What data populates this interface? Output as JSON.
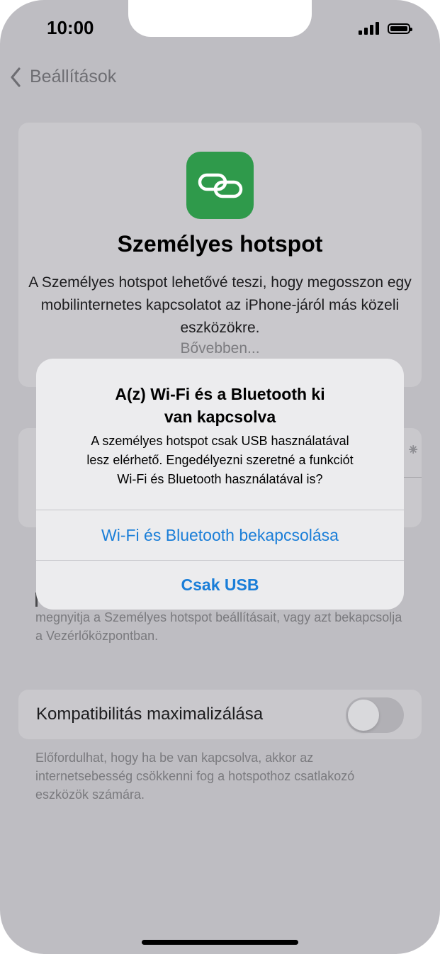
{
  "status": {
    "time": "10:00"
  },
  "nav": {
    "back_label": "Beállítások"
  },
  "hero": {
    "title": "Személyes hotspot",
    "description": "A Személyes hotspot lehetővé teszi, hogy megosszon egy mobilinternetes kapcsolatot az iPhone-járól más közeli eszközökre.",
    "more_link": "Bővebben..."
  },
  "footnote_sharing": "megnyitja a Személyes hotspot beállításait, vagy azt bekapcsolja a Vezérlőközpontban.",
  "compat": {
    "label": "Kompatibilitás maximalizálása",
    "toggle_on": false,
    "footnote": "Előfordulhat, hogy ha be van kapcsolva, akkor az internetsebesség csökkenni fog a hotspothoz csatlakozó eszközök számára."
  },
  "alert": {
    "title_line1": "A(z) Wi-Fi és a Bluetooth ki",
    "title_line2": "van kapcsolva",
    "message_line1": "A személyes hotspot csak USB használatával",
    "message_line2": "lesz elérhető. Engedélyezni szeretné a funkciót",
    "message_line3": "Wi-Fi és Bluetooth használatával is?",
    "button_primary": "Wi-Fi és Bluetooth bekapcsolása",
    "button_secondary": "Csak USB"
  },
  "colors": {
    "accent": "#1a7ed8",
    "hotspot_icon_bg": "#2f9a4b"
  }
}
